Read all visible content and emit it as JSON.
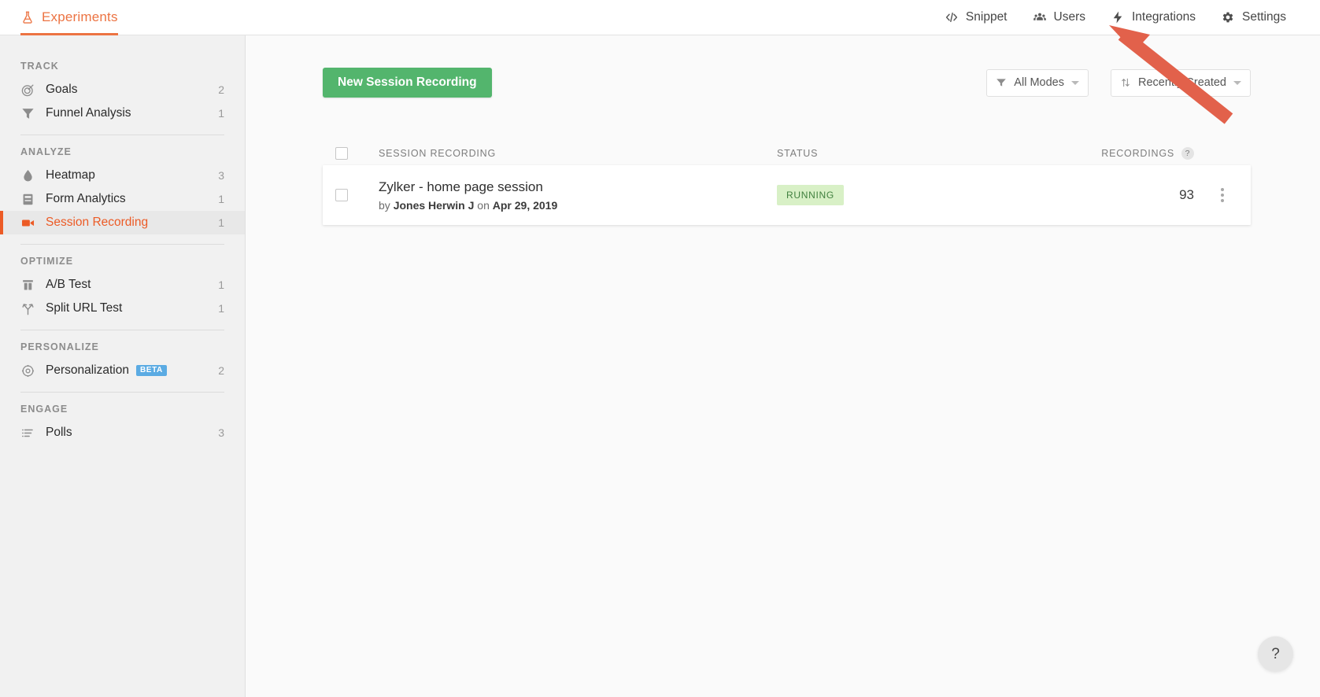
{
  "header": {
    "brand_label": "Experiments",
    "brand_icon": "flask-icon",
    "nav": [
      {
        "label": "Snippet",
        "icon": "code-icon"
      },
      {
        "label": "Users",
        "icon": "users-icon"
      },
      {
        "label": "Integrations",
        "icon": "bolt-icon"
      },
      {
        "label": "Settings",
        "icon": "gear-icon"
      }
    ]
  },
  "sidebar": {
    "groups": [
      {
        "title": "TRACK",
        "items": [
          {
            "label": "Goals",
            "count": "2",
            "icon": "target-icon",
            "active": false
          },
          {
            "label": "Funnel Analysis",
            "count": "1",
            "icon": "funnel-icon",
            "active": false
          }
        ]
      },
      {
        "title": "ANALYZE",
        "items": [
          {
            "label": "Heatmap",
            "count": "3",
            "icon": "droplet-icon",
            "active": false
          },
          {
            "label": "Form Analytics",
            "count": "1",
            "icon": "form-icon",
            "active": false
          },
          {
            "label": "Session Recording",
            "count": "1",
            "icon": "video-camera-icon",
            "active": true
          }
        ]
      },
      {
        "title": "OPTIMIZE",
        "items": [
          {
            "label": "A/B Test",
            "count": "1",
            "icon": "ab-test-icon",
            "active": false
          },
          {
            "label": "Split URL Test",
            "count": "1",
            "icon": "split-arrow-icon",
            "active": false
          }
        ]
      },
      {
        "title": "PERSONALIZE",
        "items": [
          {
            "label": "Personalization",
            "count": "2",
            "icon": "crosshair-icon",
            "badge": "BETA",
            "active": false
          }
        ]
      },
      {
        "title": "ENGAGE",
        "items": [
          {
            "label": "Polls",
            "count": "3",
            "icon": "list-icon",
            "active": false
          }
        ]
      }
    ]
  },
  "main": {
    "new_button_label": "New Session Recording",
    "filters": {
      "mode": {
        "label": "All Modes",
        "icon": "filter-icon"
      },
      "sort": {
        "label": "Recently Created",
        "icon": "sort-icon"
      }
    },
    "table": {
      "columns": {
        "session_recording": "SESSION RECORDING",
        "status": "STATUS",
        "recordings": "RECORDINGS",
        "recordings_help": "?"
      },
      "rows": [
        {
          "title": "Zylker - home page session",
          "meta_prefix": "by ",
          "author": "Jones Herwin J",
          "meta_mid": " on ",
          "date": "Apr 29, 2019",
          "status": "RUNNING",
          "recordings": "93"
        }
      ]
    }
  },
  "help_fab": {
    "label": "?"
  },
  "colors": {
    "brand_orange": "#ec7342",
    "active_orange": "#ec5b26",
    "primary_green": "#53b56d",
    "badge_bg": "#d8f0c6",
    "badge_text": "#41803f",
    "beta_blue": "#5babe3",
    "annotation_red": "#e2614b"
  }
}
